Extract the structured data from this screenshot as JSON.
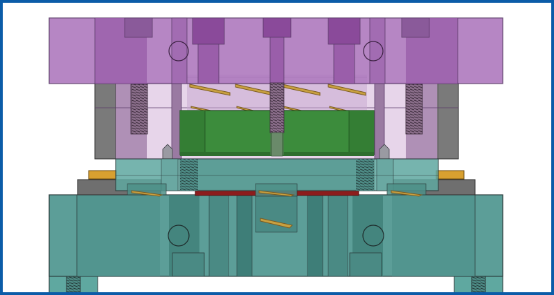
{
  "view": {
    "frame_color": "#0b5ca8",
    "background": "#ffffff"
  },
  "colors": {
    "top_plate": "#b07cc0",
    "top_plate_edge": "#5a3a68",
    "upper_pale": "#e7d5ea",
    "pillar": "#7a7a7a",
    "stripper": "#5fa8a0",
    "die_block": "#5c9e98",
    "die_dark": "#4b8a84",
    "edge": "#2c3c3c",
    "green_part": "#3c8c3c",
    "green_dark": "#2e6e2e",
    "red_strip": "#8c1c1c",
    "spring": "#c8a040",
    "spring_dark": "#7a5a20",
    "gold_pad": "#d8a030",
    "thread": "#6a5a6a"
  },
  "components": [
    "top-plate",
    "guide-pillar-left",
    "guide-pillar-right",
    "spring-set",
    "green-workpiece",
    "stripper-plate",
    "red-strip",
    "die-block",
    "base-feet"
  ]
}
